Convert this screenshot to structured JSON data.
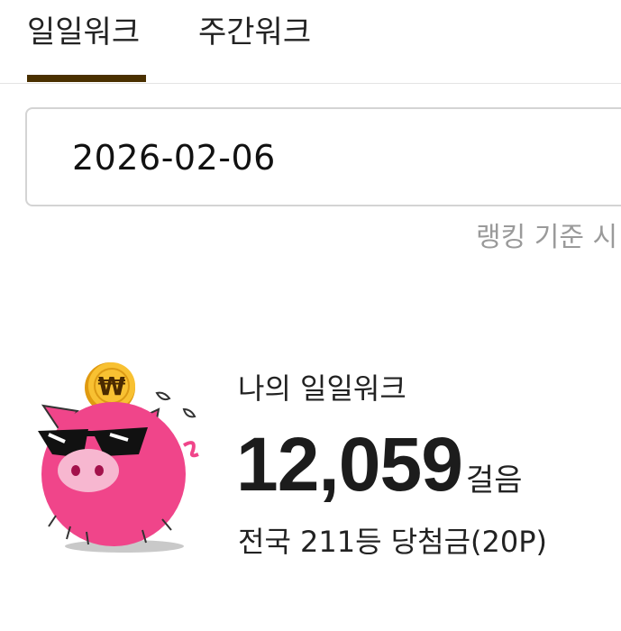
{
  "tabs": [
    {
      "label": "일일워크",
      "active": true
    },
    {
      "label": "주간워크",
      "active": false
    }
  ],
  "date_field": {
    "value": "2026-02-06"
  },
  "ranking_note": "랭킹 기준 시",
  "my_walk": {
    "title": "나의 일일워크",
    "steps": "12,059",
    "steps_unit": "걸음",
    "rank_text": "전국 211등 당첨금(20P)"
  },
  "mascot": {
    "coin_symbol": "₩",
    "icon": "pig-mascot-icon"
  },
  "colors": {
    "tab_underline": "#4a3000",
    "pig_pink": "#f0458a",
    "coin_gold": "#f5b51c",
    "note_gray": "#9a9a9a"
  }
}
